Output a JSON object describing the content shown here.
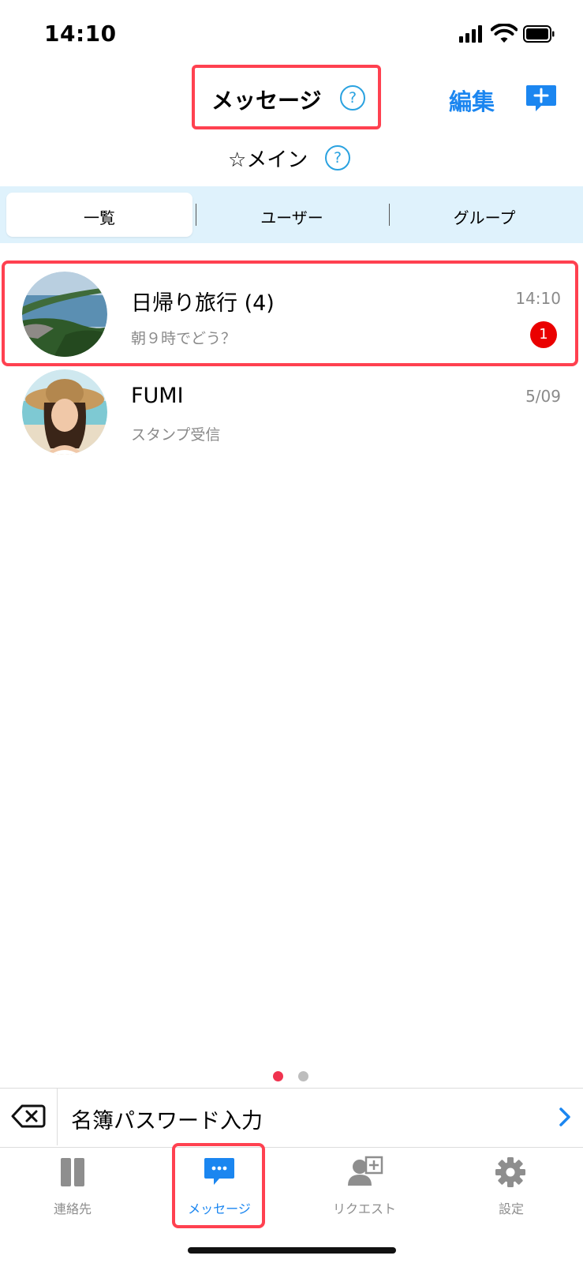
{
  "status_bar": {
    "time": "14:10"
  },
  "header": {
    "title": "メッセージ",
    "help": "?",
    "edit_label": "編集",
    "sub_title": "☆メイン",
    "sub_help": "?"
  },
  "segments": [
    {
      "label": "一覧",
      "selected": true
    },
    {
      "label": "ユーザー",
      "selected": false
    },
    {
      "label": "グループ",
      "selected": false
    }
  ],
  "threads": [
    {
      "name": "日帰り旅行 (4)",
      "preview": "朝９時でどう？",
      "time": "14:10",
      "unread": "1"
    },
    {
      "name": "FUMI",
      "preview": "スタンプ受信",
      "time": "5/09"
    }
  ],
  "pager": {
    "count": 2,
    "active": 1,
    "active_color": "#f0334f",
    "inactive_color": "#bdbdbd"
  },
  "password_bar": {
    "label": "名簿パスワード入力",
    "chevron": "›"
  },
  "tabs": [
    {
      "label": "連絡先",
      "icon": "contacts-icon",
      "active": false
    },
    {
      "label": "メッセージ",
      "icon": "chat-icon",
      "active": true
    },
    {
      "label": "リクエスト",
      "icon": "add-user-icon",
      "active": false
    },
    {
      "label": "設定",
      "icon": "gear-icon",
      "active": false
    }
  ],
  "colors": {
    "accent": "#1b86f0",
    "highlight": "#ff4150",
    "badge": "#ea0000",
    "segment_bg": "#dff2fc"
  }
}
